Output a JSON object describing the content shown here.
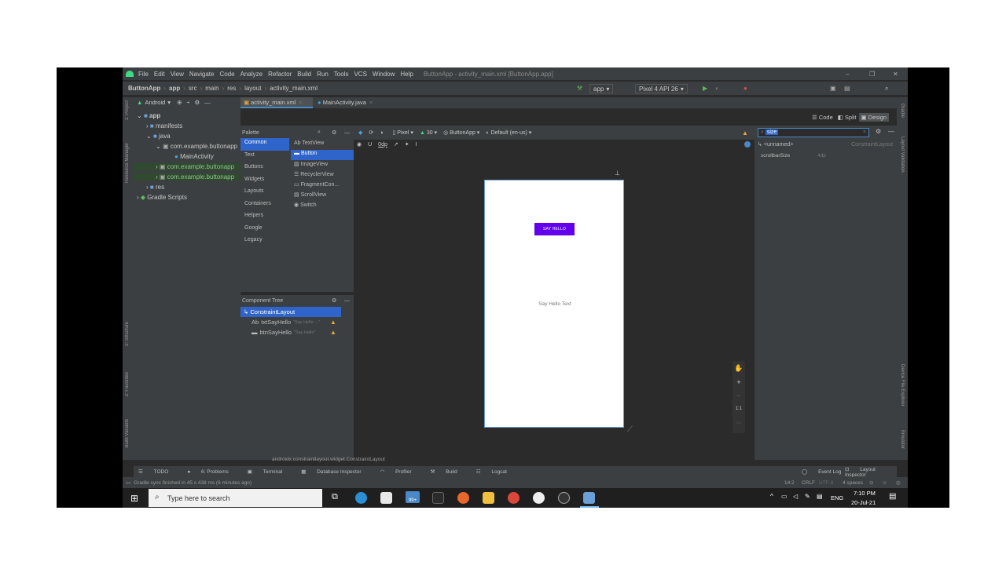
{
  "menu": {
    "items": [
      "File",
      "Edit",
      "View",
      "Navigate",
      "Code",
      "Analyze",
      "Refactor",
      "Build",
      "Run",
      "Tools",
      "VCS",
      "Window",
      "Help"
    ],
    "title": "ButtonApp - activity_main.xml [ButtonApp.app]"
  },
  "nav": {
    "crumbs": [
      "ButtonApp",
      "app",
      "src",
      "main",
      "res",
      "layout",
      "activity_main.xml"
    ],
    "config": "app",
    "device": "Pixel 4 API 26"
  },
  "project": {
    "view": "Android",
    "tree": [
      {
        "label": "app",
        "indent": 0
      },
      {
        "label": "manifests",
        "indent": 1
      },
      {
        "label": "java",
        "indent": 1
      },
      {
        "label": "com.example.buttonapp",
        "indent": 2
      },
      {
        "label": "MainActivity",
        "indent": 3
      },
      {
        "label": "com.example.buttonapp",
        "indent": 2
      },
      {
        "label": "com.example.buttonapp",
        "indent": 2
      },
      {
        "label": "res",
        "indent": 1
      },
      {
        "label": "Gradle Scripts",
        "indent": 0
      }
    ]
  },
  "side_labels": {
    "left": [
      "1: Project",
      "Resource Manager",
      "2: Structure",
      "2: Favorites",
      "Build Variants"
    ],
    "right": [
      "Gradle",
      "Layout Validation",
      "Device File Explorer",
      "Emulator"
    ]
  },
  "tabs": [
    "activity_main.xml",
    "MainActivity.java"
  ],
  "view_modes": [
    "Code",
    "Split",
    "Design"
  ],
  "palette": {
    "title": "Palette",
    "categories": [
      "Common",
      "Text",
      "Buttons",
      "Widgets",
      "Layouts",
      "Containers",
      "Helpers",
      "Google",
      "Legacy"
    ],
    "widgets": [
      "Ab TextView",
      "Button",
      "ImageView",
      "RecyclerView",
      "FragmentCon...",
      "ScrollView",
      "Switch"
    ]
  },
  "design_toolbar": {
    "margin": "0dp",
    "device": "Pixel",
    "api": "30",
    "theme": "ButtonApp",
    "locale": "Default (en-us)"
  },
  "component_tree": {
    "title": "Component Tree",
    "root": "ConstraintLayout",
    "children": [
      {
        "id": "txtSayHello",
        "hint": "\"Say Hello ...\"",
        "prefix": "Ab"
      },
      {
        "id": "btnSayHello",
        "hint": "\"Say Hello\"",
        "prefix": ""
      }
    ]
  },
  "preview": {
    "button_text": "SAY HELLO",
    "text": "Say Hello Text"
  },
  "attributes": {
    "search_value": "size",
    "component": "<unnamed>",
    "component_type": "ConstraintLayout",
    "props": [
      {
        "name": "scrollbarSize",
        "value": "4dp"
      }
    ]
  },
  "zoom_controls": [
    "+",
    "−",
    "1:1"
  ],
  "breadcrumb_bottom": "androidx.constraintlayout.widget.ConstraintLayout",
  "bottom_tabs": [
    "TODO",
    "6: Problems",
    "Terminal",
    "Database Inspector",
    "Profiler",
    "Build",
    "Logcat"
  ],
  "bottom_right_tabs": [
    "Event Log",
    "Layout Inspector"
  ],
  "status": {
    "message": "Gradle sync finished in 45 s 438 ms (6 minutes ago)",
    "position": "14:2",
    "line_sep": "CRLF",
    "encoding": "UTF-8",
    "indent": "4 spaces"
  },
  "taskbar": {
    "search_placeholder": "Type here to search",
    "time": "7:10 PM",
    "date": "20-Jul-21",
    "lang": "ENG",
    "store_badge": "99+"
  },
  "colors": {
    "ide_bg": "#2b2b2b",
    "panel_bg": "#3c3f41",
    "button_purple": "#6200ee",
    "selection_blue": "#2f65ca"
  }
}
